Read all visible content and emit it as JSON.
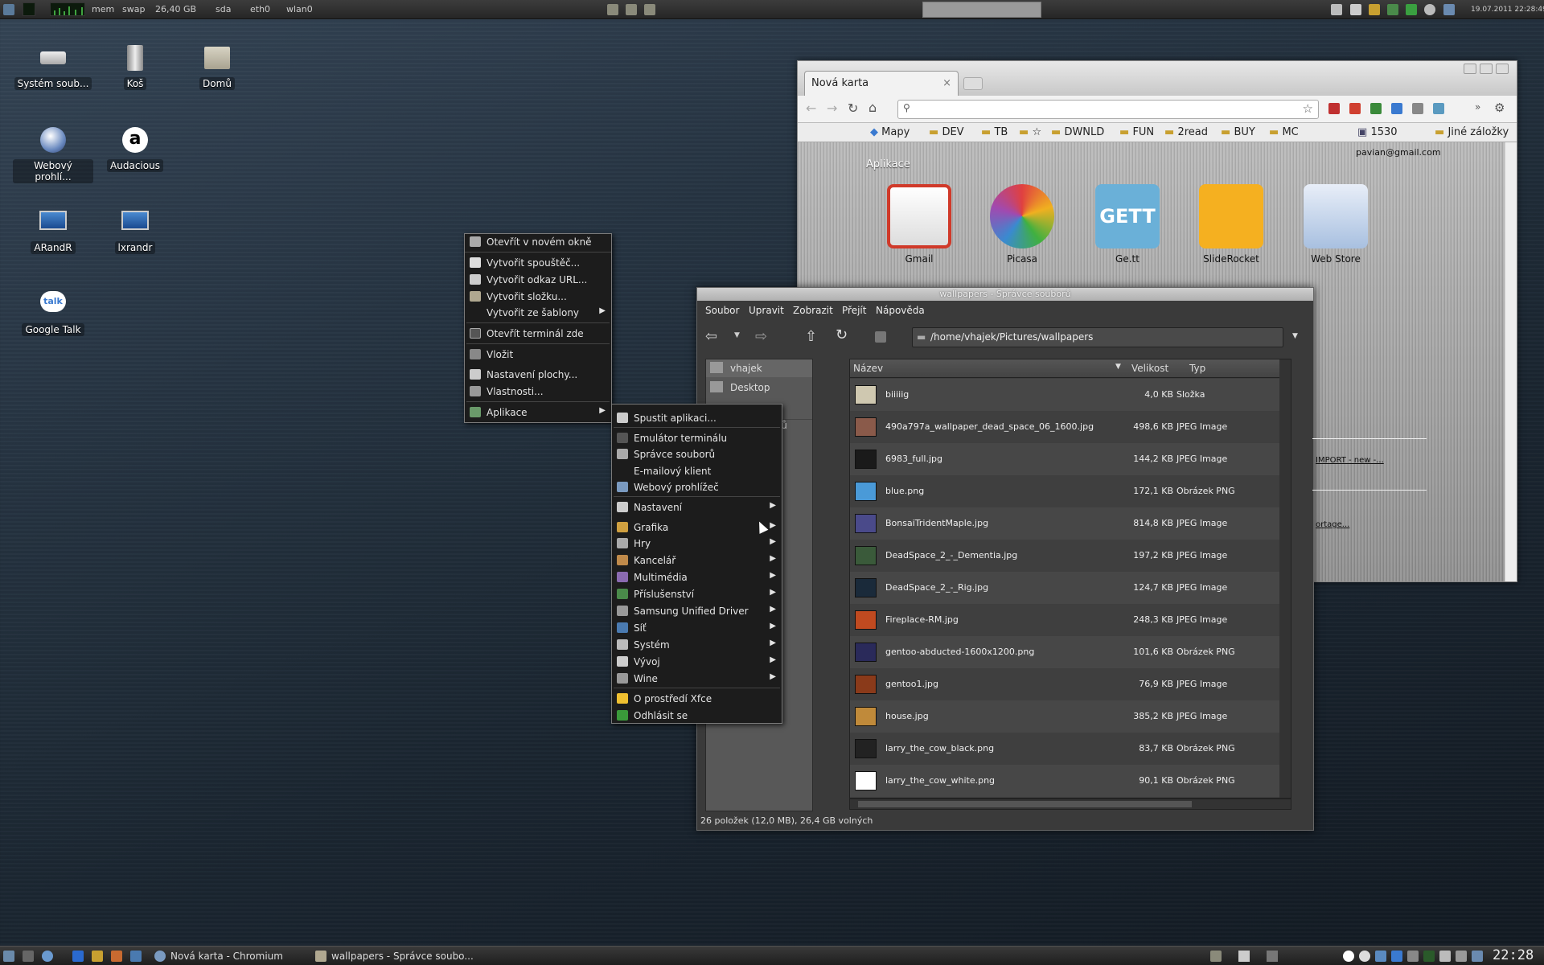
{
  "top_panel": {
    "mem": "mem",
    "swap": "swap",
    "disk": "26,40 GB",
    "sda": "sda",
    "eth": "eth0",
    "wlan": "wlan0",
    "datetime": "19.07.2011 22:28:49"
  },
  "desktop_icons": [
    {
      "label": "Systém soub...",
      "icon": "drive-icon"
    },
    {
      "label": "Koš",
      "icon": "trash-icon"
    },
    {
      "label": "Domů",
      "icon": "home-folder-icon"
    },
    {
      "label": "Webový prohlí...",
      "icon": "web-browser-icon"
    },
    {
      "label": "Audacious",
      "icon": "audacious-icon"
    },
    {
      "label": "ARandR",
      "icon": "monitor-icon"
    },
    {
      "label": "lxrandr",
      "icon": "monitor-icon"
    },
    {
      "label": "Google Talk",
      "icon": "google-talk-icon"
    }
  ],
  "chromium": {
    "tab_title": "Nová karta",
    "bookmarks": [
      "Mapy",
      "DEV",
      "TB",
      "☆",
      "DWNLD",
      "FUN",
      "2read",
      "BUY",
      "MC",
      "1530"
    ],
    "other_bookmarks": "Jiné záložky",
    "user": "pavian@gmail.com",
    "section": "Aplikace",
    "apps": [
      "Gmail",
      "Picasa",
      "Ge.tt",
      "SlideRocket",
      "Web Store"
    ],
    "side_links": [
      "IMPORT - new -...",
      "ortage..."
    ]
  },
  "file_manager": {
    "title": "wallpapers - Správce souborů",
    "menu": [
      "Soubor",
      "Upravit",
      "Zobrazit",
      "Přejít",
      "Nápověda"
    ],
    "path": "/home/vhajek/Pictures/wallpapers",
    "side": [
      "vhajek",
      "Desktop",
      "oborů"
    ],
    "columns": {
      "name": "Název",
      "size": "Velikost",
      "type": "Typ"
    },
    "files": [
      {
        "name": "biiiiig",
        "size": "4,0 KB",
        "type": "Složka"
      },
      {
        "name": "490a797a_wallpaper_dead_space_06_1600.jpg",
        "size": "498,6 KB",
        "type": "JPEG Image"
      },
      {
        "name": "6983_full.jpg",
        "size": "144,2 KB",
        "type": "JPEG Image"
      },
      {
        "name": "blue.png",
        "size": "172,1 KB",
        "type": "Obrázek PNG"
      },
      {
        "name": "BonsaiTridentMaple.jpg",
        "size": "814,8 KB",
        "type": "JPEG Image"
      },
      {
        "name": "DeadSpace_2_-_Dementia.jpg",
        "size": "197,2 KB",
        "type": "JPEG Image"
      },
      {
        "name": "DeadSpace_2_-_Rig.jpg",
        "size": "124,7 KB",
        "type": "JPEG Image"
      },
      {
        "name": "Fireplace-RM.jpg",
        "size": "248,3 KB",
        "type": "JPEG Image"
      },
      {
        "name": "gentoo-abducted-1600x1200.png",
        "size": "101,6 KB",
        "type": "Obrázek PNG"
      },
      {
        "name": "gentoo1.jpg",
        "size": "76,9 KB",
        "type": "JPEG Image"
      },
      {
        "name": "house.jpg",
        "size": "385,2 KB",
        "type": "JPEG Image"
      },
      {
        "name": "larry_the_cow_black.png",
        "size": "83,7 KB",
        "type": "Obrázek PNG"
      },
      {
        "name": "larry_the_cow_white.png",
        "size": "90,1 KB",
        "type": "Obrázek PNG"
      }
    ],
    "status": "26 položek (12,0 MB), 26,4 GB volných"
  },
  "desktop_menu": [
    {
      "label": "Otevřít v novém okně"
    },
    {
      "label": "Vytvořit spouštěč..."
    },
    {
      "label": "Vytvořit odkaz URL..."
    },
    {
      "label": "Vytvořit složku..."
    },
    {
      "label": "Vytvořit ze šablony"
    },
    {
      "label": "Otevřít terminál zde"
    },
    {
      "label": "Vložit"
    },
    {
      "label": "Nastavení plochy..."
    },
    {
      "label": "Vlastnosti..."
    },
    {
      "label": "Aplikace"
    }
  ],
  "apps_menu": [
    {
      "label": "Spustit aplikaci..."
    },
    {
      "label": "Emulátor terminálu"
    },
    {
      "label": "Správce souborů"
    },
    {
      "label": "E-mailový klient"
    },
    {
      "label": "Webový prohlížeč"
    },
    {
      "label": "Nastavení"
    },
    {
      "label": "Grafika"
    },
    {
      "label": "Hry"
    },
    {
      "label": "Kancelář"
    },
    {
      "label": "Multimédia"
    },
    {
      "label": "Příslušenství"
    },
    {
      "label": "Samsung Unified Driver"
    },
    {
      "label": "Síť"
    },
    {
      "label": "Systém"
    },
    {
      "label": "Vývoj"
    },
    {
      "label": "Wine"
    },
    {
      "label": "O prostředí Xfce"
    },
    {
      "label": "Odhlásit se"
    }
  ],
  "taskbar": {
    "tasks": [
      "Nová karta - Chromium",
      "wallpapers - Správce soubo..."
    ],
    "clock": "22:28"
  }
}
